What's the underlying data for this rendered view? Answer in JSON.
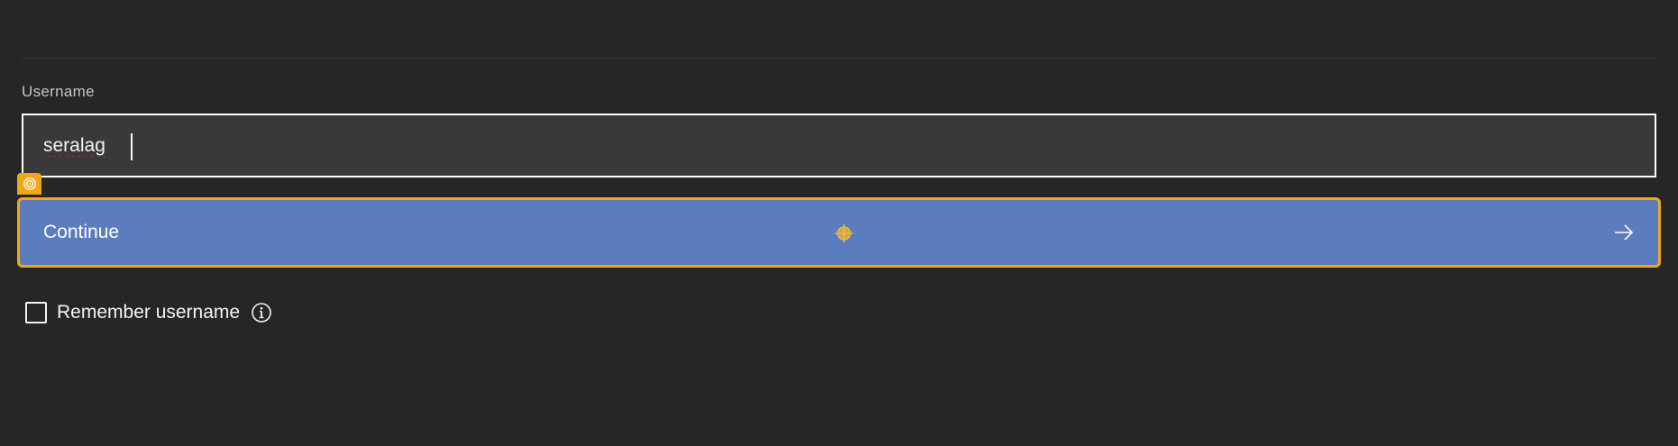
{
  "form": {
    "username_label": "Username",
    "username_value": "seralag",
    "continue_label": "Continue",
    "remember_label": "Remember username",
    "remember_checked": false
  },
  "icons": {
    "target_badge": "target-icon",
    "center_marker": "crosshair-icon",
    "arrow": "arrow-right-icon",
    "info": "info-icon"
  },
  "colors": {
    "background": "#262626",
    "field_background": "#393939",
    "button_primary": "#5b7dbf",
    "focus_highlight": "#f1a71a",
    "text": "#f4f4f4"
  }
}
